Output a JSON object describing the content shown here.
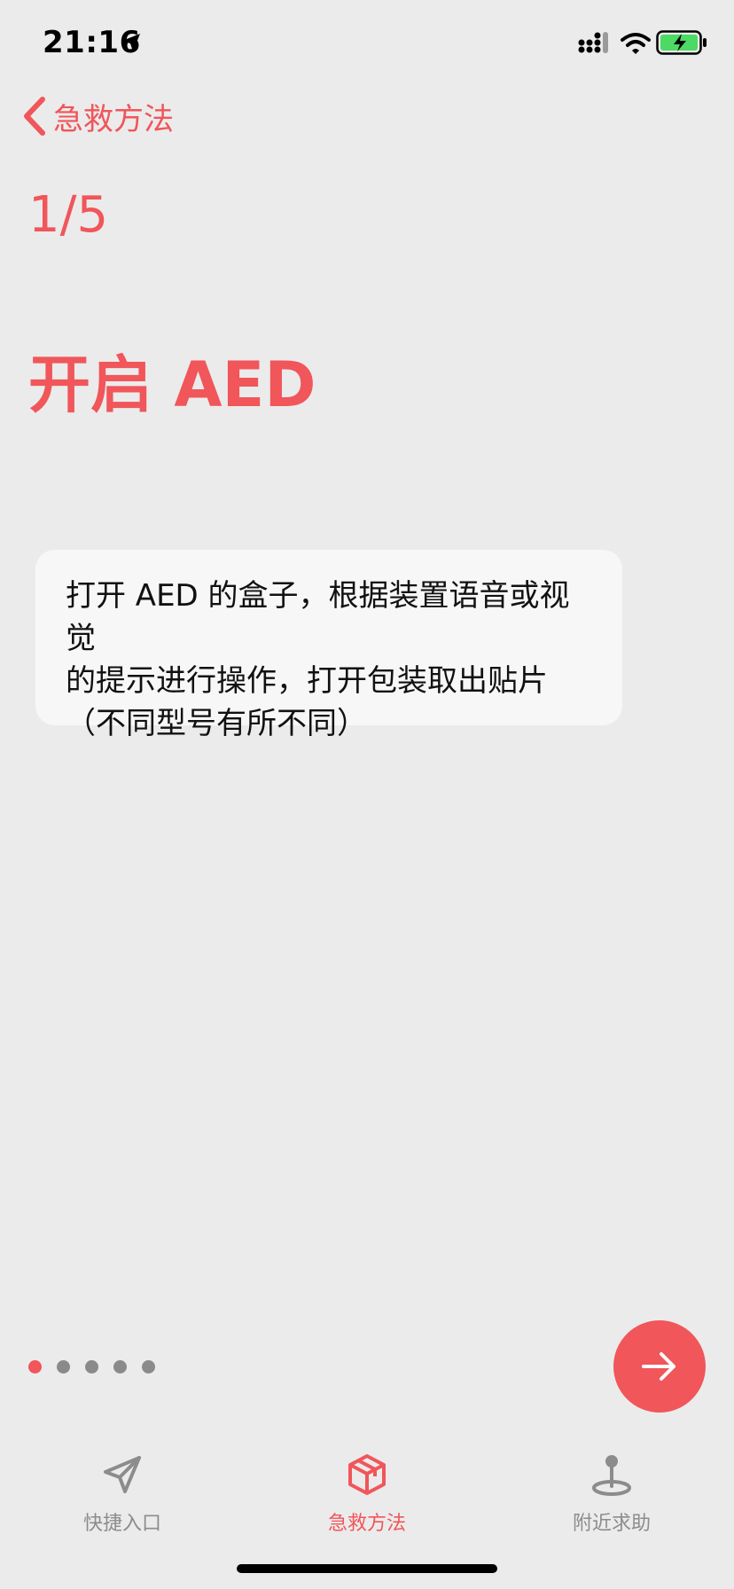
{
  "status_bar": {
    "time": "21:16"
  },
  "nav": {
    "back_label": "急救方法"
  },
  "step": {
    "counter": "1/5",
    "title": "开启 AED",
    "description": "打开 AED 的盒子，根据装置语音或视觉\n的提示进行操作，打开包装取出贴片\n（不同型号有所不同）"
  },
  "pager": {
    "total": 5,
    "current": 1
  },
  "tabbar": {
    "items": [
      {
        "label": "快捷入口",
        "icon": "paper-plane-icon"
      },
      {
        "label": "急救方法",
        "icon": "box-icon"
      },
      {
        "label": "附近求助",
        "icon": "map-pin-icon"
      }
    ],
    "active_index": 1
  },
  "colors": {
    "accent": "#f0565a",
    "background": "#ebebeb",
    "card": "#f7f7f7",
    "inactive": "#8c8c8c"
  }
}
